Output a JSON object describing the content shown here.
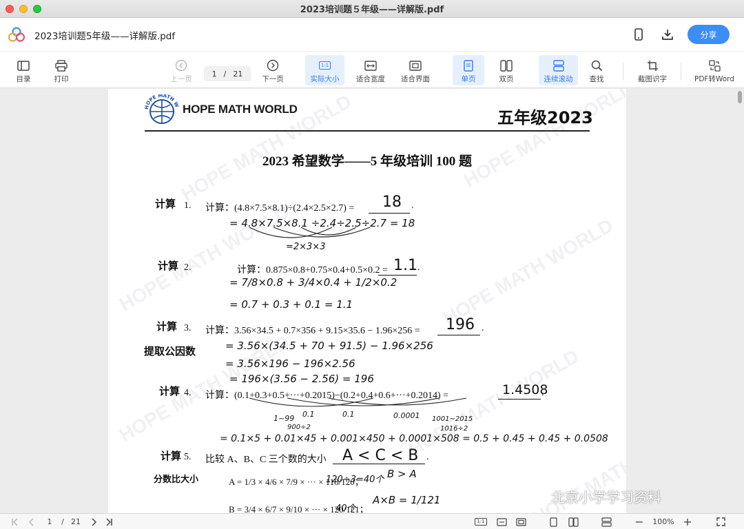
{
  "window": {
    "title": "2023培训题５年级——详解版.pdf"
  },
  "header": {
    "doc_title": "2023培训题5年级——详解版.pdf",
    "share_label": "分享"
  },
  "toolbar": {
    "toc": "目录",
    "print": "打印",
    "prev_page": "上一页",
    "current_page": "1",
    "page_sep": "/",
    "total_pages": "21",
    "next_page": "下一页",
    "actual_size": "实际大小",
    "fit_width": "适合宽度",
    "fit_screen": "适合界面",
    "single_page": "单页",
    "two_page": "双页",
    "continuous_scroll": "连续滚动",
    "find": "查找",
    "screenshot_ocr": "截图识字",
    "pdf_to_word": "PDF转Word",
    "actual_size_icon_text": "1:1"
  },
  "page": {
    "brand": "HOPE MATH WORLD",
    "logo_ring_text": "HOPE MATH WORLD",
    "grade_year": "五年级2023",
    "heading": "2023 希望数学——5 年级培训 100 题",
    "watermark_text": "HOPE MATH WORLD",
    "wechat_badge": "北京小学学习资料",
    "problems": [
      {
        "side_note": "计算",
        "number": "1.",
        "text": "计算：(4.8×7.5×8.1)÷(2.4×2.5×2.7) =",
        "answer": "18",
        "work": [
          "= 4.8×7.5×8.1 ÷2.4÷2.5÷2.7 = 18",
          "=2×3×3"
        ]
      },
      {
        "side_note": "计算",
        "number": "2.",
        "text": "计算：0.875×0.8+0.75×0.4+0.5×0.2 =",
        "answer": "1.1",
        "work": [
          "= 7/8×0.8 + 3/4×0.4 + 1/2×0.2",
          "= 0.7 + 0.3 + 0.1 = 1.1"
        ]
      },
      {
        "side_note": "计算",
        "side_note_2": "提取公因数",
        "number": "3.",
        "text": "计算：3.56×34.5 + 0.7×356 + 9.15×35.6 − 1.96×256 =",
        "answer": "196",
        "work": [
          "= 3.56×(34.5 + 70 + 91.5) − 1.96×256",
          "= 3.56×196 − 196×2.56",
          "= 196×(3.56 − 2.56) = 196"
        ]
      },
      {
        "side_note": "计算",
        "number": "4.",
        "text": "计算：(0.1+0.3+0.5+···+0.2015)−(0.2+0.4+0.6+···+0.2014) =",
        "answer": "1.4508",
        "work_top": [
          "0.1",
          "0.1",
          "0.0001",
          "1~99",
          "900÷2",
          "1001~2015",
          "1016÷2"
        ],
        "work": [
          "= 0.1×5 + 0.01×45 + 0.001×450 + 0.0001×508 = 0.5 + 0.45 + 0.45 + 0.0508"
        ]
      },
      {
        "side_note": "计算",
        "side_note_2": "分数比大小",
        "number": "5.",
        "text": "比较 A、B、C 三个数的大小",
        "answer": "A < C < B",
        "line_a": "A = 1/3 × 4/6 × 7/9 × ··· × 118/120；",
        "line_b": "B = 3/4 × 6/7 × 9/10 × ··· × 120/121；",
        "work": [
          "120÷3=40个",
          "B > A",
          "A×B = 1/121",
          "40个"
        ]
      }
    ]
  },
  "statusbar": {
    "current_page": "1",
    "page_sep": "/",
    "total_pages": "21",
    "zoom": "100%",
    "actual_size_icon_text": "1:1"
  },
  "colors": {
    "accent": "#3b8ef6",
    "active_bg": "#e6f0fd",
    "active_fg": "#2f7cf0"
  }
}
